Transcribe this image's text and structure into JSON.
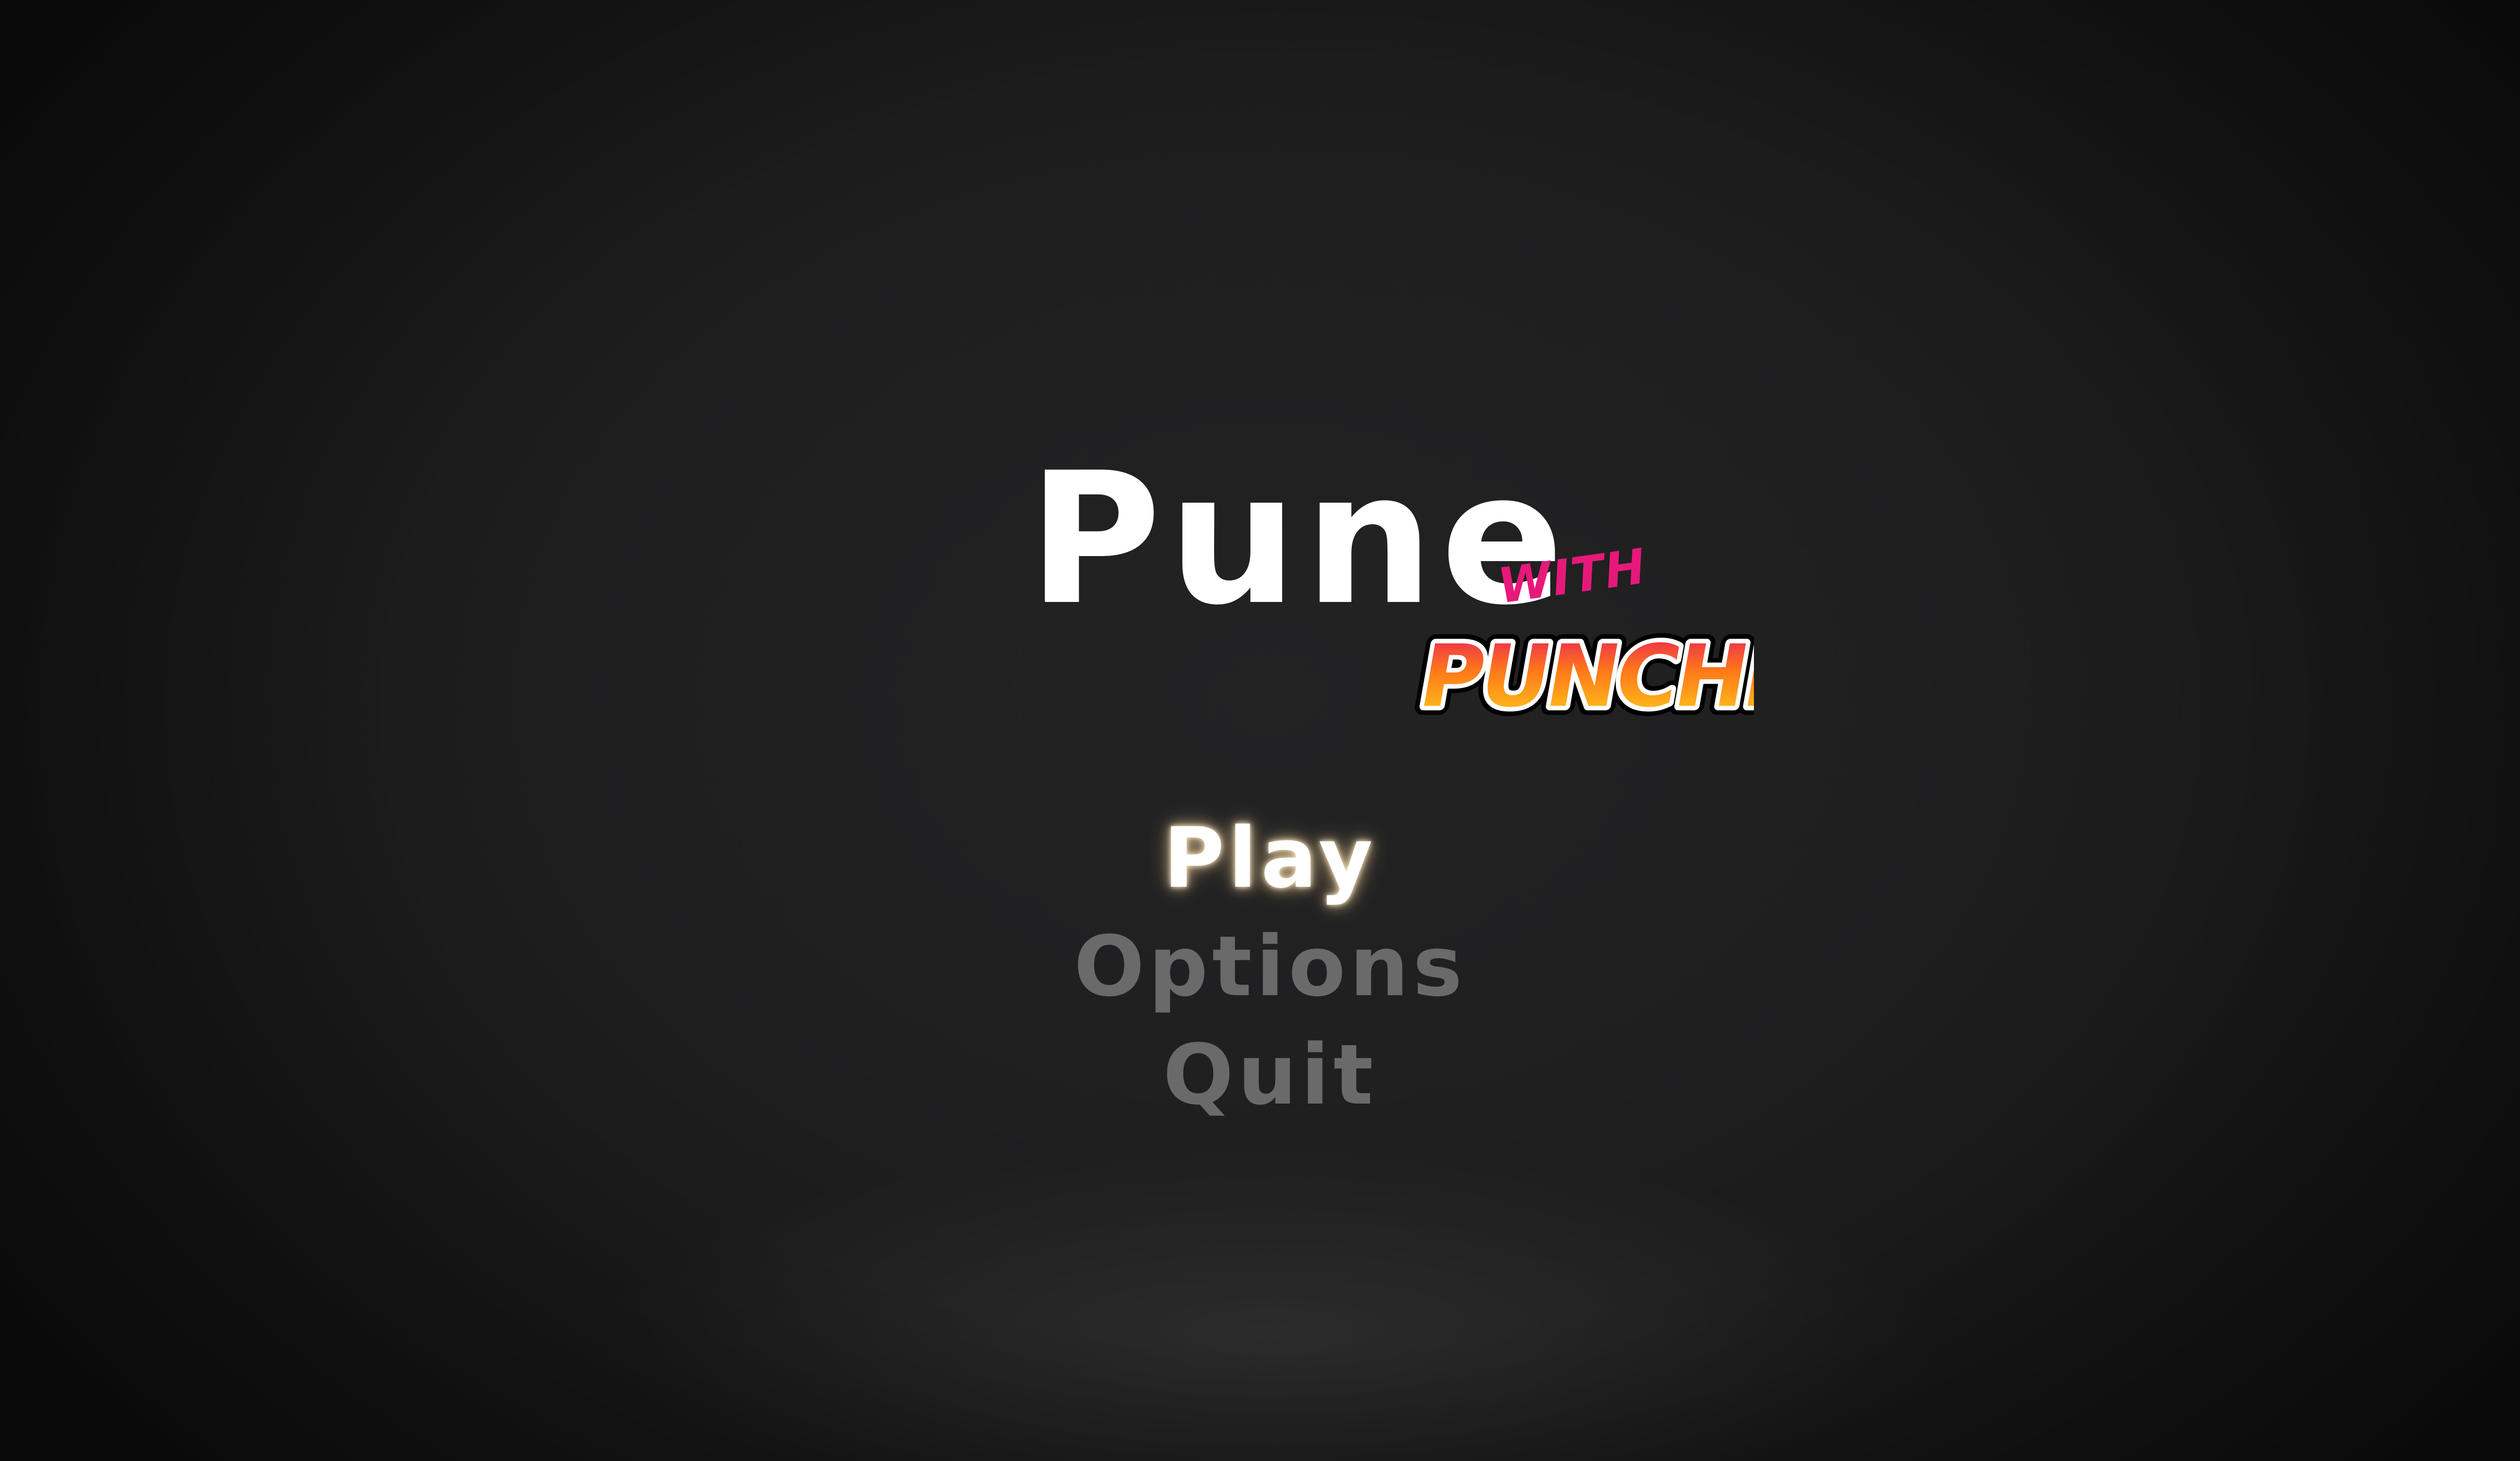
{
  "title": {
    "main": "Pune",
    "with": "WITH",
    "punchis": "PUNCHIS"
  },
  "menu": {
    "items": [
      {
        "label": "Play",
        "selected": true
      },
      {
        "label": "Options",
        "selected": false
      },
      {
        "label": "Quit",
        "selected": false
      }
    ]
  },
  "colors": {
    "background": "#1b1b1c",
    "title": "#ffffff",
    "with_accent": "#e6197a",
    "punchis_top": "#e8175d",
    "punchis_mid": "#ff7a1a",
    "punchis_bottom": "#ffd31a",
    "menu_selected": "#ffffff",
    "menu_glow": "#ffe1aa",
    "menu_unselected": "#6a6a6a"
  }
}
